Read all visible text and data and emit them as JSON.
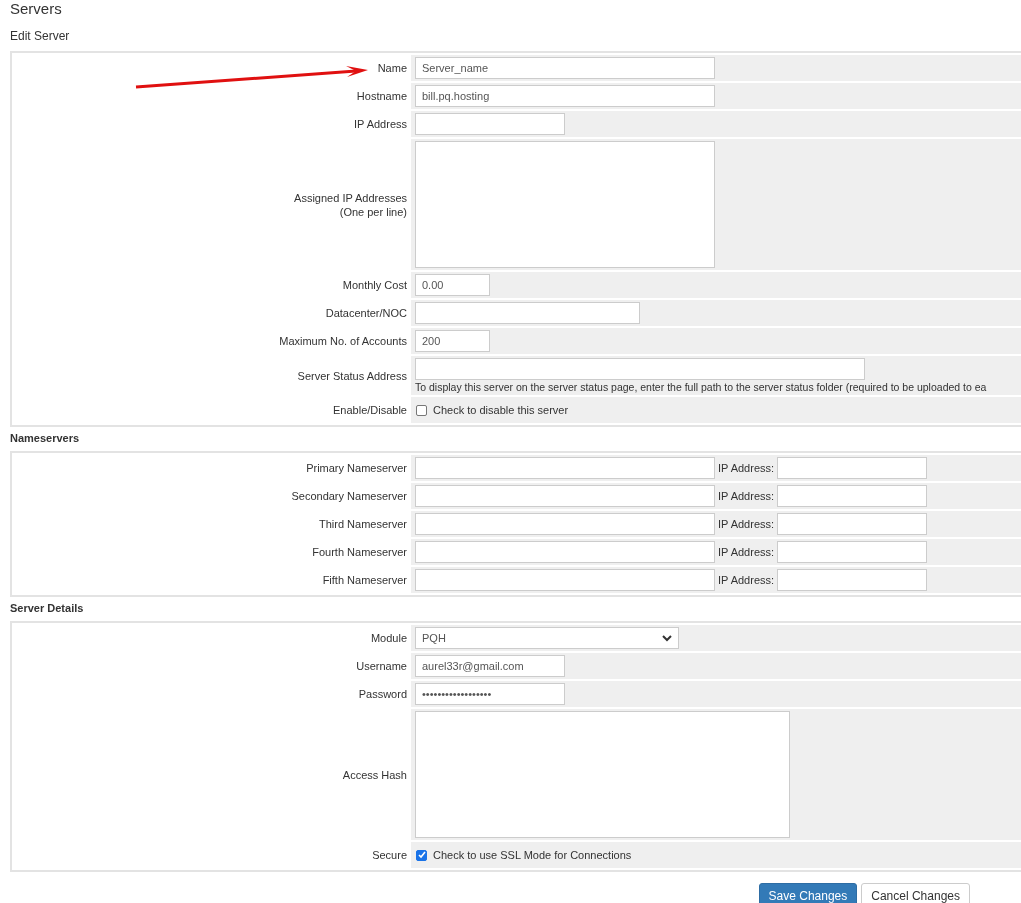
{
  "page_title": "Servers",
  "subtitle": "Edit Server",
  "server_fields": [
    {
      "kind": "wide",
      "label": "Name",
      "value": "Server_name"
    },
    {
      "kind": "wide",
      "label": "Hostname",
      "value": "bill.pq.hosting"
    },
    {
      "kind": "short",
      "label": "IP Address"
    },
    {
      "kind": "textarea",
      "label": "Assigned IP Addresses",
      "sublabel": "(One per line)"
    },
    {
      "kind": "small",
      "label": "Monthly Cost",
      "value": "0.00"
    },
    {
      "kind": "medium",
      "label": "Datacenter/NOC"
    },
    {
      "kind": "small",
      "label": "Maximum No. of Accounts",
      "value": "200"
    },
    {
      "kind": "status",
      "label": "Server Status Address",
      "help": "To display this server on the server status page, enter the full path to the server status folder (required to be uploaded to ea"
    },
    {
      "kind": "checkbox",
      "label": "Enable/Disable",
      "text": "Check to disable this server",
      "checked": false
    }
  ],
  "nameservers_heading": "Nameservers",
  "nameservers": [
    {
      "label": "Primary Nameserver",
      "ip_label": "IP Address:"
    },
    {
      "label": "Secondary Nameserver",
      "ip_label": "IP Address:"
    },
    {
      "label": "Third Nameserver",
      "ip_label": "IP Address:"
    },
    {
      "label": "Fourth Nameserver",
      "ip_label": "IP Address:"
    },
    {
      "label": "Fifth Nameserver",
      "ip_label": "IP Address:"
    }
  ],
  "details_heading": "Server Details",
  "detail_fields": [
    {
      "kind": "select",
      "label": "Module",
      "value": "PQH"
    },
    {
      "kind": "short",
      "label": "Username",
      "value": "aurel33r@gmail.com"
    },
    {
      "kind": "short",
      "label": "Password",
      "value": "••••••••••••••••••"
    },
    {
      "kind": "hash",
      "label": "Access Hash"
    },
    {
      "kind": "checkbox",
      "label": "Secure",
      "text": "Check to use SSL Mode for Connections",
      "checked": true
    }
  ],
  "buttons": [
    {
      "kind": "primary",
      "label": "Save Changes"
    },
    {
      "kind": "default",
      "label": "Cancel Changes"
    }
  ]
}
